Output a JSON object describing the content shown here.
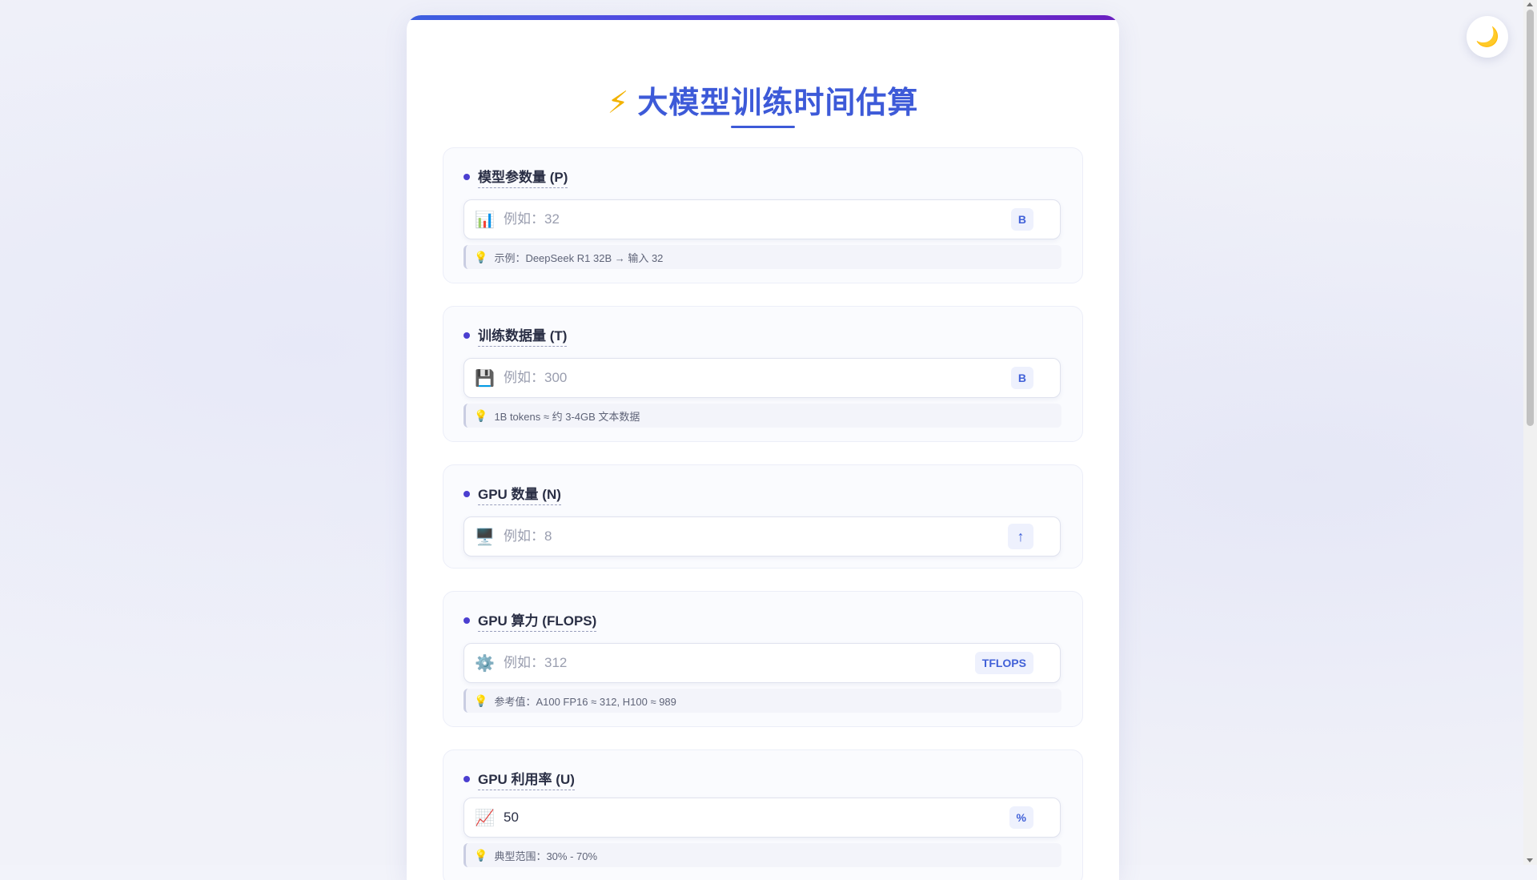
{
  "page": {
    "title_icon": "⚡",
    "title": "大模型训练时间估算",
    "theme_toggle_icon": "🌙"
  },
  "fields": [
    {
      "label": "模型参数量 (P)",
      "icon": "📊",
      "icon_name": "bar-chart-icon",
      "placeholder": "例如：32",
      "value": "",
      "unit": "B",
      "hint": "示例：DeepSeek R1 32B → 输入 32"
    },
    {
      "label": "训练数据量 (T)",
      "icon": "💾",
      "icon_name": "floppy-disk-icon",
      "placeholder": "例如：300",
      "value": "",
      "unit": "B",
      "hint": "1B tokens ≈ 约 3-4GB 文本数据"
    },
    {
      "label": "GPU 数量 (N)",
      "icon": "🖥️",
      "icon_name": "desktop-computer-icon",
      "placeholder": "例如：8",
      "value": "",
      "unit_icon": "↑",
      "unit_icon_name": "arrow-up-icon"
    },
    {
      "label": "GPU 算力 (FLOPS)",
      "icon": "⚙️",
      "icon_name": "gear-icon",
      "placeholder": "例如：312",
      "value": "",
      "unit": "TFLOPS",
      "hint": "参考值：A100 FP16 ≈ 312, H100 ≈ 989"
    },
    {
      "label": "GPU 利用率 (U)",
      "icon": "📈",
      "icon_name": "trending-up-chart-icon",
      "placeholder": "",
      "value": "50",
      "unit": "%",
      "hint": "典型范围：30% - 70%"
    }
  ],
  "hint_icon": "💡",
  "colors": {
    "accent": "#3d5ad8",
    "accent_purple": "#5b3ee0",
    "unit_bg": "#eef1fd"
  }
}
